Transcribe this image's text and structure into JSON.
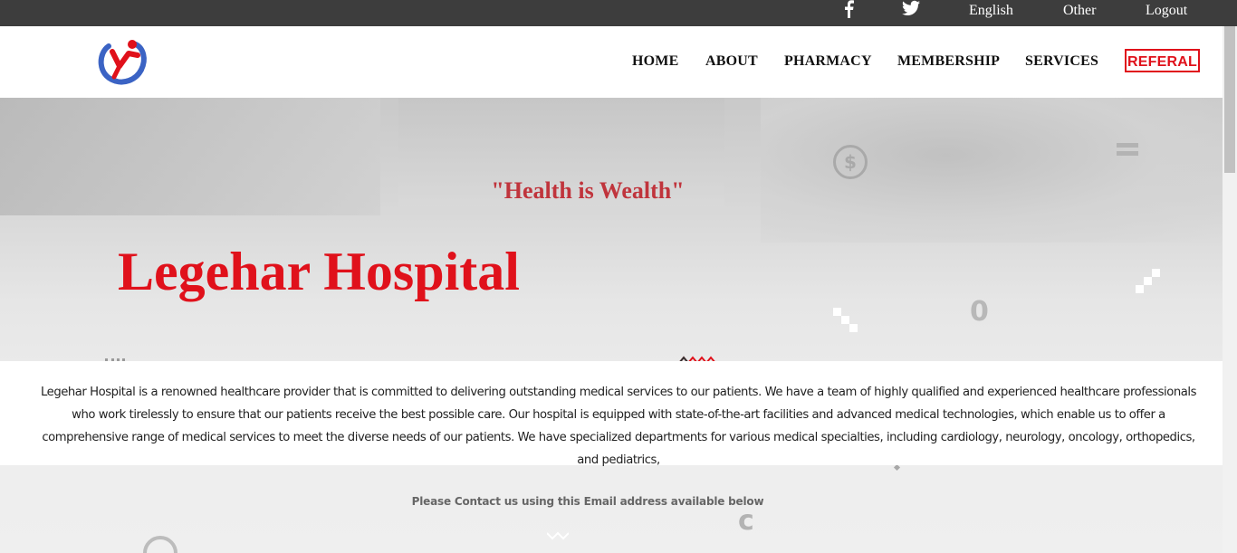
{
  "topbar": {
    "facebook_icon": "facebook-icon",
    "twitter_icon": "twitter-icon",
    "language": "English",
    "other": "Other",
    "logout": "Logout"
  },
  "navbar": {
    "logo_icon": "hospital-logo",
    "items": [
      "HOME",
      "ABOUT",
      "PHARMACY",
      "MEMBERSHIP",
      "SERVICES",
      "REFERAL"
    ]
  },
  "hero": {
    "tagline": "\"Health is Wealth\"",
    "title": "Legehar Hospital"
  },
  "about": {
    "text": "Legehar Hospital is a renowned healthcare provider that is committed to delivering outstanding medical services to our patients. We have a team of highly qualified and experienced healthcare professionals who work tirelessly to ensure that our patients receive the best possible care. Our hospital is equipped with state-of-the-art facilities and advanced medical technologies, which enable us to offer a comprehensive range of medical services to meet the diverse needs of our patients. We have specialized departments for various medical specialties, including cardiology, neurology, oncology, orthopedics, and pediatrics,"
  },
  "contact": {
    "text": "Please Contact us using this Email address available below"
  },
  "colors": {
    "accent_red": "#e0111b",
    "tagline_red": "#c0343c",
    "topbar_bg": "#3d3d3d"
  }
}
